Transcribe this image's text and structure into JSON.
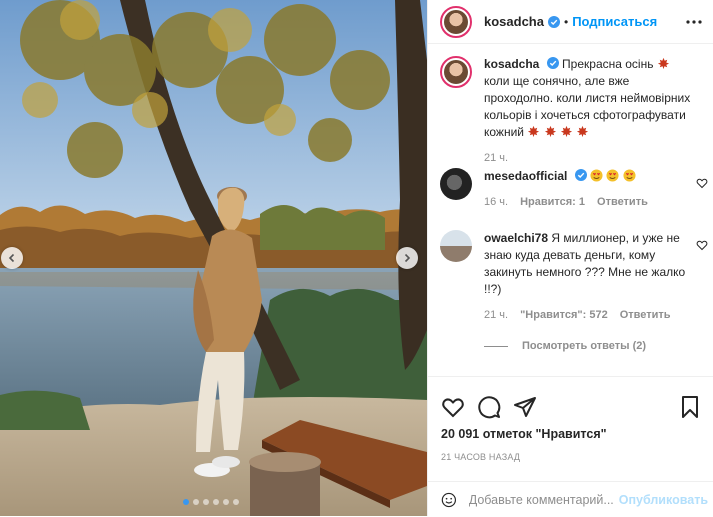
{
  "colors": {
    "link_blue": "#0095f6",
    "verified_blue": "#3897f0",
    "muted": "#8e8e8e",
    "divider": "#efefef",
    "story_ring": "#e1306c"
  },
  "header": {
    "username": "kosadcha",
    "separator": "•",
    "follow_label": "Подписаться",
    "more_icon": "more-horizontal-icon"
  },
  "photo": {
    "nav_prev_icon": "chevron-left-icon",
    "nav_next_icon": "chevron-right-icon",
    "carousel": {
      "count": 6,
      "active_index": 0
    }
  },
  "caption": {
    "username": "kosadcha",
    "text_1": "Прекрасна осінь",
    "text_2": "коли ще сонячно, але вже проходолно. коли листя неймовірних кольорів і хочеться сфотографувати кожний",
    "time": "21 ч."
  },
  "comments": [
    {
      "username": "mesedaofficial",
      "text": "",
      "time": "16 ч.",
      "likes_label": "Нравится: 1",
      "reply_label": "Ответить"
    },
    {
      "username": "owaelchi78",
      "text": "Я миллионер, и уже не знаю куда девать деньги, кому закинуть немного ??? Мне не жалко !!?)",
      "time": "21 ч.",
      "likes_label": "\"Нравится\": 572",
      "reply_label": "Ответить",
      "view_replies": "Посмотреть ответы (2)"
    }
  ],
  "actions": {
    "like_icon": "heart-icon",
    "comment_icon": "comment-icon",
    "share_icon": "share-icon",
    "save_icon": "bookmark-icon",
    "likes_text": "20 091 отметок \"Нравится\"",
    "timestamp": "21 ЧАСОВ НАЗАД"
  },
  "add_comment": {
    "emoji_icon": "smiley-icon",
    "placeholder": "Добавьте комментарий...",
    "post_label": "Опубликовать"
  }
}
